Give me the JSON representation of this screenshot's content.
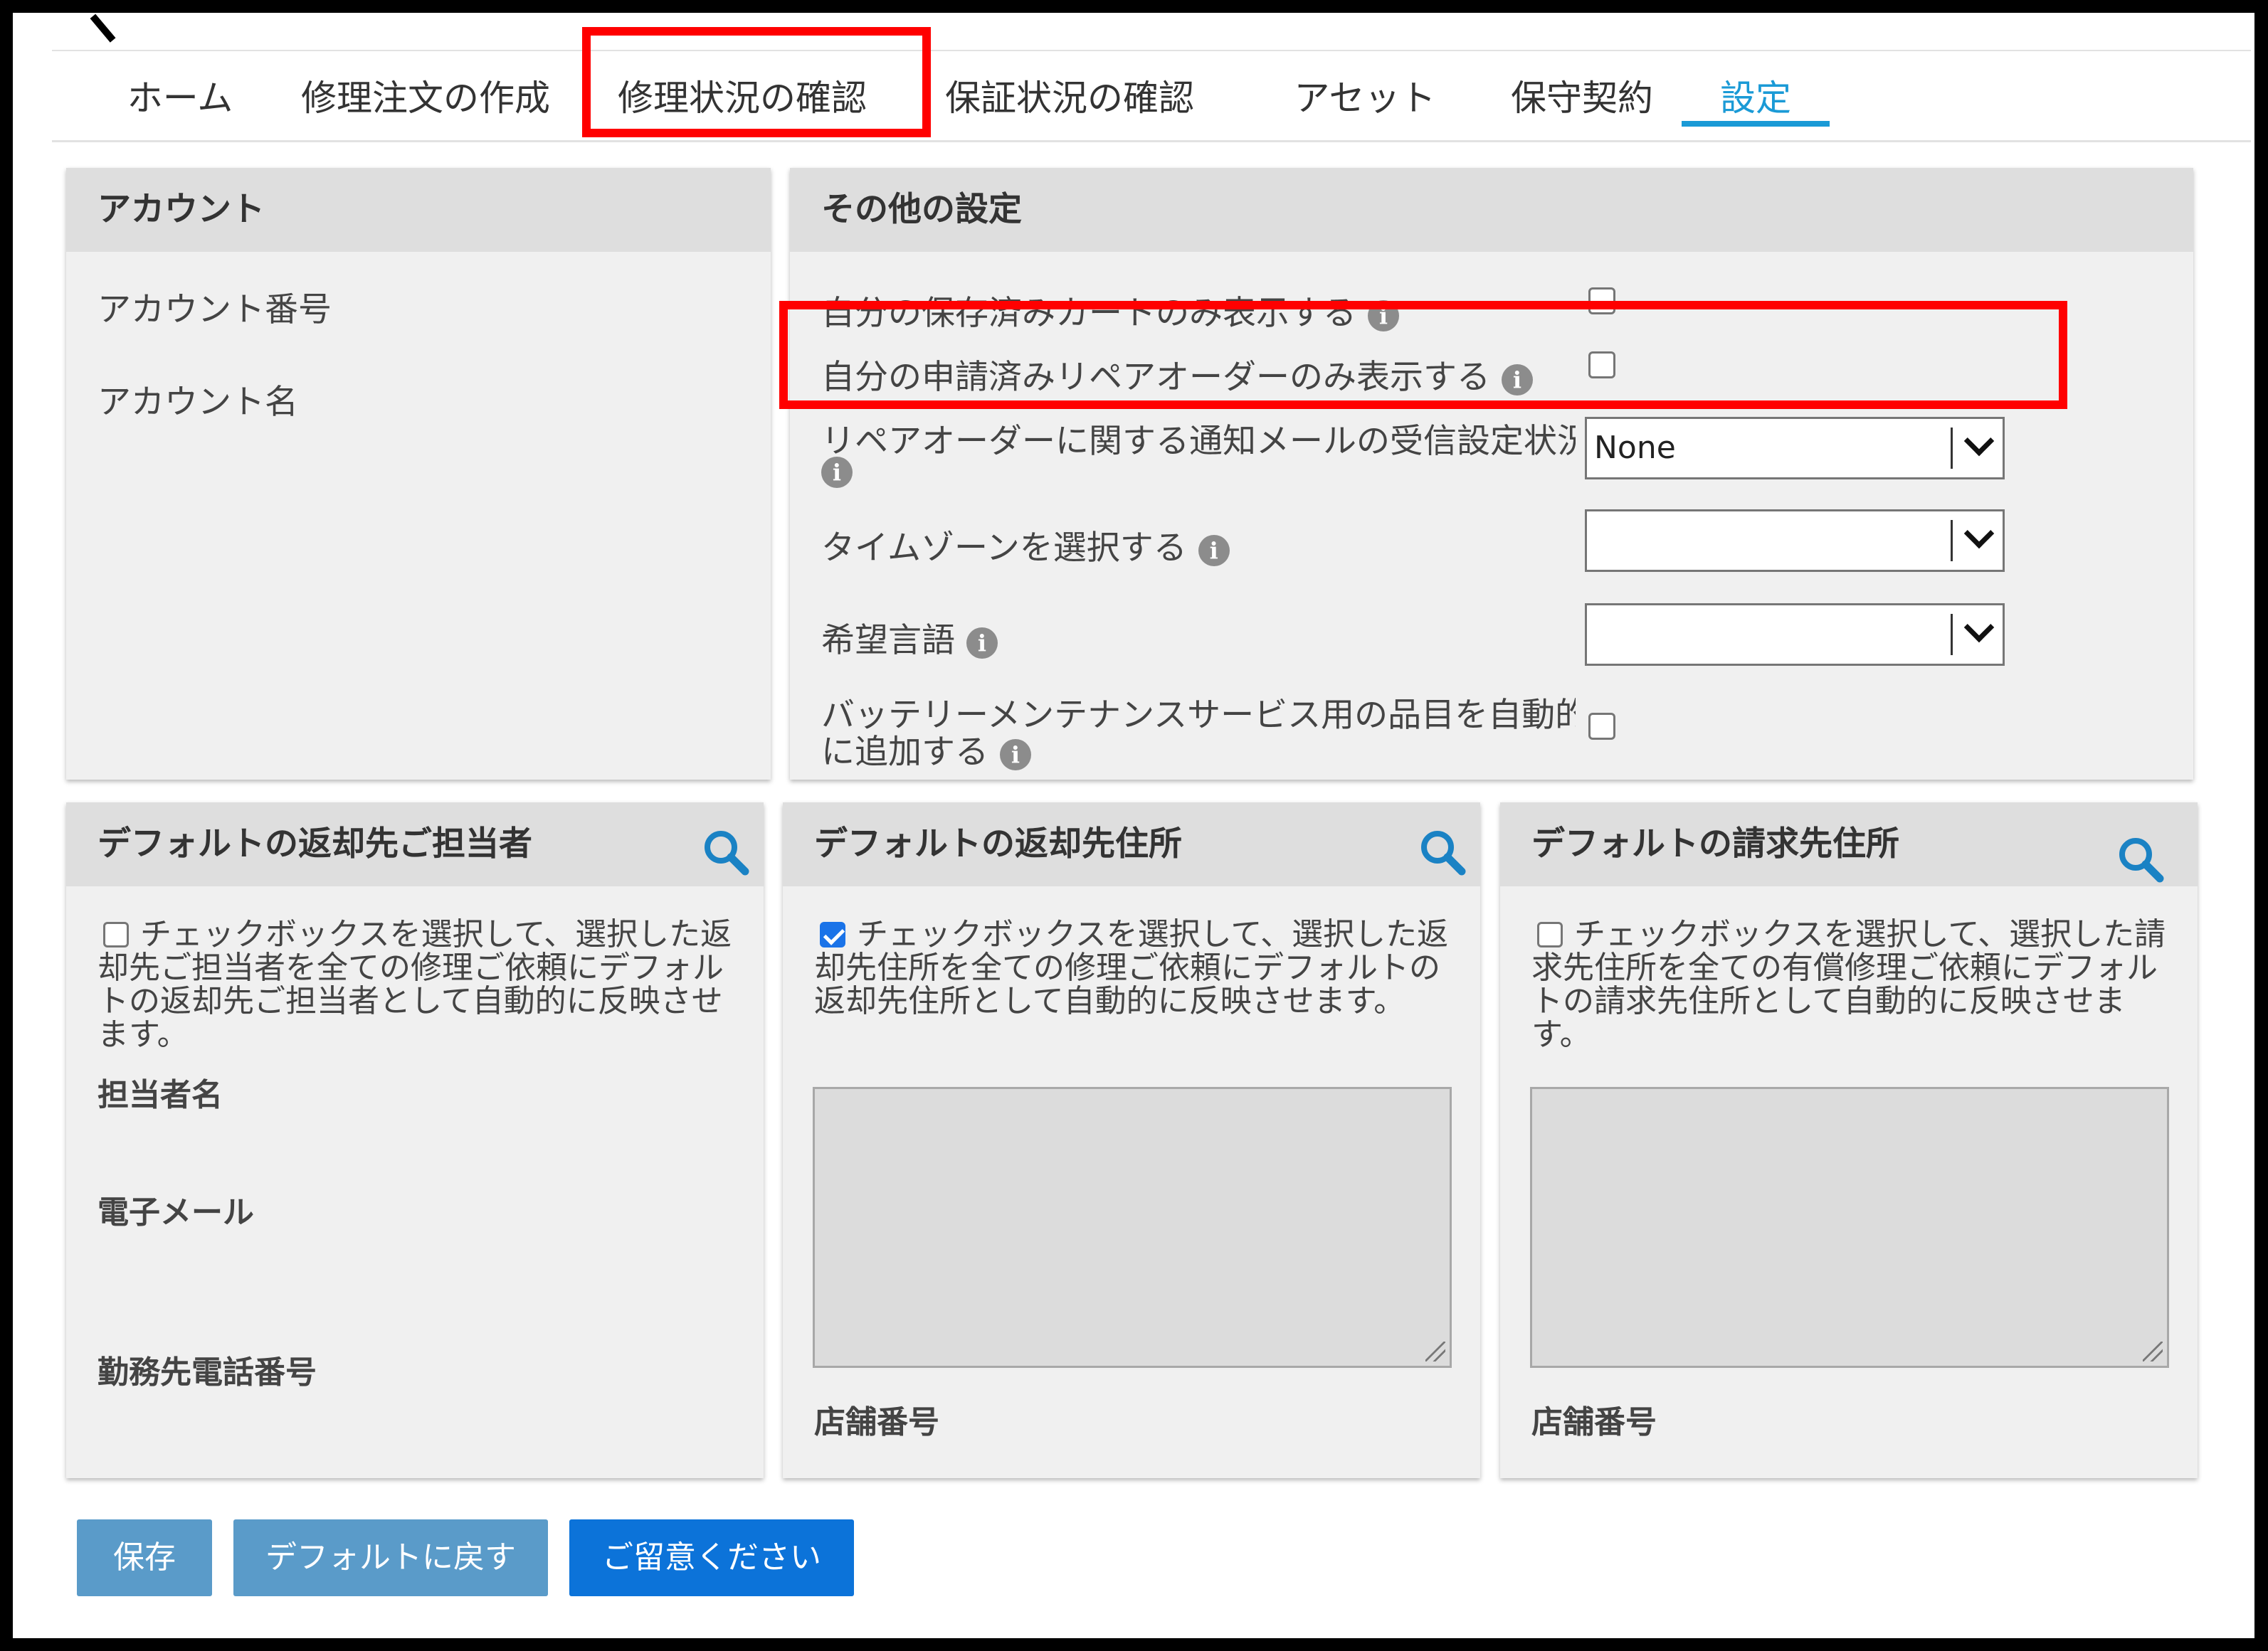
{
  "nav": {
    "tabs": [
      {
        "label": "ホーム"
      },
      {
        "label": "修理注文の作成"
      },
      {
        "label": "修理状況の確認"
      },
      {
        "label": "保証状況の確認"
      },
      {
        "label": "アセット"
      },
      {
        "label": "保守契約"
      },
      {
        "label": "設定"
      }
    ],
    "active_tab": "設定"
  },
  "account_panel": {
    "title": "アカウント",
    "account_number_label": "アカウント番号",
    "account_name_label": "アカウント名"
  },
  "other_settings": {
    "title": "その他の設定",
    "saved_cart_label": "自分の保存済みカートのみ表示する",
    "repair_order_label": "自分の申請済みリペアオーダーのみ表示する",
    "notify_mail_label": "リペアオーダーに関する通知メールの受信設定状況",
    "notify_mail_value": "None",
    "timezone_label": "タイムゾーンを選択する",
    "timezone_value": "",
    "language_label": "希望言語",
    "language_value": "",
    "battery_label_line1": "バッテリーメンテナンスサービス用の品目を自動的",
    "battery_label_line2": "に追加する"
  },
  "return_contact": {
    "title": "デフォルトの返却先ご担当者",
    "checkbox_text": "チェックボックスを選択して、選択した返却先ご担当者を全ての修理ご依頼にデフォルトの返却先ご担当者として自動的に反映させます。",
    "checked": false,
    "name_label": "担当者名",
    "email_label": "電子メール",
    "phone_label": "勤務先電話番号"
  },
  "return_address": {
    "title": "デフォルトの返却先住所",
    "checkbox_text": "チェックボックスを選択して、選択した返却先住所を全ての修理ご依頼にデフォルトの返却先住所として自動的に反映させます。",
    "checked": true,
    "store_label": "店舗番号"
  },
  "billing_address": {
    "title": "デフォルトの請求先住所",
    "checkbox_text": "チェックボックスを選択して、選択した請求先住所を全ての有償修理ご依頼にデフォルトの請求先住所として自動的に反映させます。",
    "checked": false,
    "store_label": "店舗番号"
  },
  "buttons": {
    "save": "保存",
    "reset": "デフォルトに戻す",
    "notice": "ご留意ください"
  },
  "colors": {
    "accent": "#1a9ad6",
    "highlight": "#ff0000",
    "button_muted": "#5a9bc9",
    "button_primary": "#0c73d9"
  }
}
